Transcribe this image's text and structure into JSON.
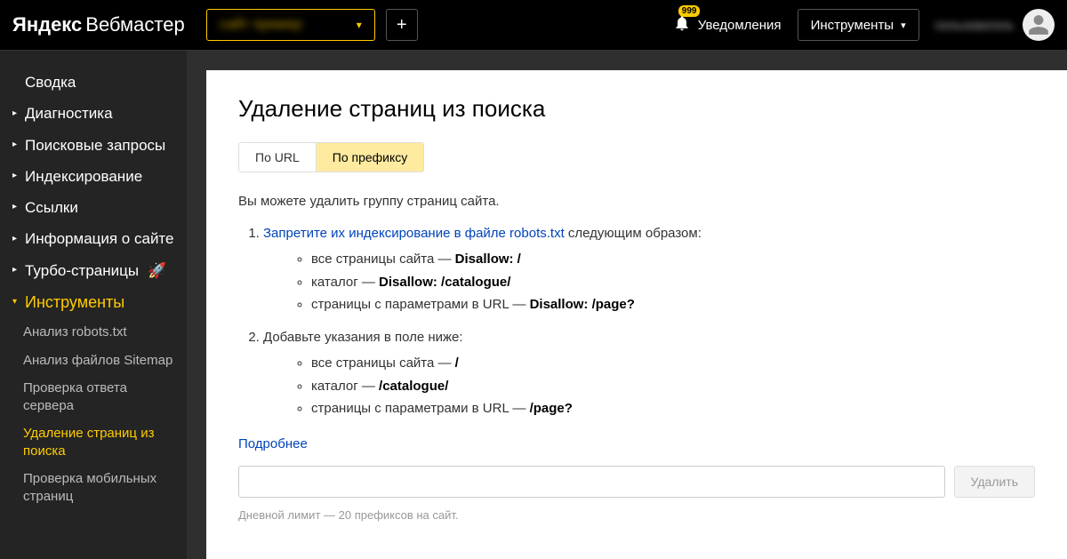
{
  "header": {
    "logo_yandex": "Яндекс",
    "logo_service": "Вебмастер",
    "site_selector": "сайт пример",
    "plus_label": "+",
    "notif_label": "Уведомления",
    "notif_count": "999",
    "tools_label": "Инструменты",
    "username": "пользователь"
  },
  "sidebar": {
    "svodka": "Сводка",
    "diagnostika": "Диагностика",
    "poiskovye": "Поисковые запросы",
    "index": "Индексирование",
    "ssylki": "Ссылки",
    "info": "Информация о сайте",
    "turbo": "Турбо-страницы",
    "tools": "Инструменты",
    "sub": {
      "robots": "Анализ robots.txt",
      "sitemap": "Анализ файлов Sitemap",
      "server": "Проверка ответа сервера",
      "delete": "Удаление страниц из поиска",
      "mobile": "Проверка мобильных страниц"
    }
  },
  "main": {
    "title": "Удаление страниц из поиска",
    "tabs": {
      "url": "По URL",
      "prefix": "По префиксу"
    },
    "intro": "Вы можете удалить группу страниц сайта.",
    "step1_link": "Запретите их индексирование в файле robots.txt",
    "step1_after": " следующим образом:",
    "s1a": "все страницы сайта — ",
    "s1a_b": "Disallow: /",
    "s1b": "каталог — ",
    "s1b_b": "Disallow: /catalogue/",
    "s1c": "страницы с параметрами в URL — ",
    "s1c_b": "Disallow: /page?",
    "step2": "Добавьте указания в поле ниже:",
    "s2a": "все страницы сайта — ",
    "s2a_b": "/",
    "s2b": "каталог — ",
    "s2b_b": "/catalogue/",
    "s2c": "страницы с параметрами в URL — ",
    "s2c_b": "/page?",
    "more": "Подробнее",
    "delete_btn": "Удалить",
    "limit": "Дневной лимит — 20 префиксов на сайт."
  }
}
